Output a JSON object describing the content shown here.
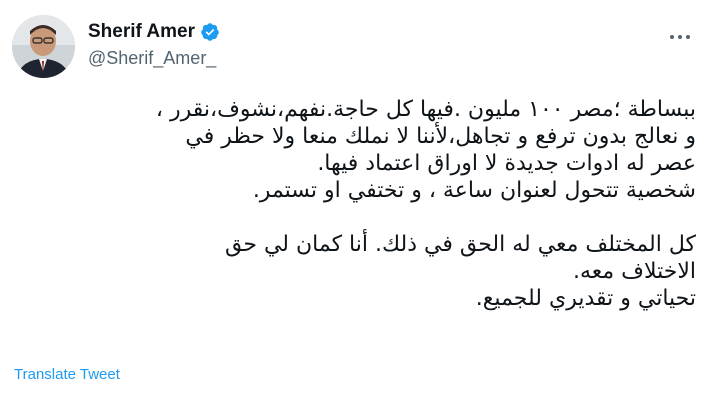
{
  "author": {
    "name": "Sherif Amer",
    "handle": "@Sherif_Amer_",
    "verified": true
  },
  "icons": {
    "verified": "verified-badge-icon",
    "more": "more-options-icon"
  },
  "colors": {
    "accent": "#1d9bf0",
    "text": "#0f1419",
    "secondary": "#536471"
  },
  "tweet": {
    "lines": [
      "ببساطة ؛مصر ١٠٠ مليون .فيها كل حاجة.نفهم،نشوف،نقرر ،",
      "و نعالج بدون ترفع و تجاهل،لأننا لا نملك منعا ولا حظر في",
      "عصر له ادوات جديدة لا اوراق اعتماد فيها.",
      "شخصية تتحول لعنوان ساعة ، و تختفي او تستمر.",
      "",
      "كل المختلف معي له الحق في ذلك. أنا كمان لي حق",
      "الاختلاف معه.",
      "تحياتي و تقديري للجميع."
    ]
  },
  "actions": {
    "translate": "Translate Tweet"
  }
}
